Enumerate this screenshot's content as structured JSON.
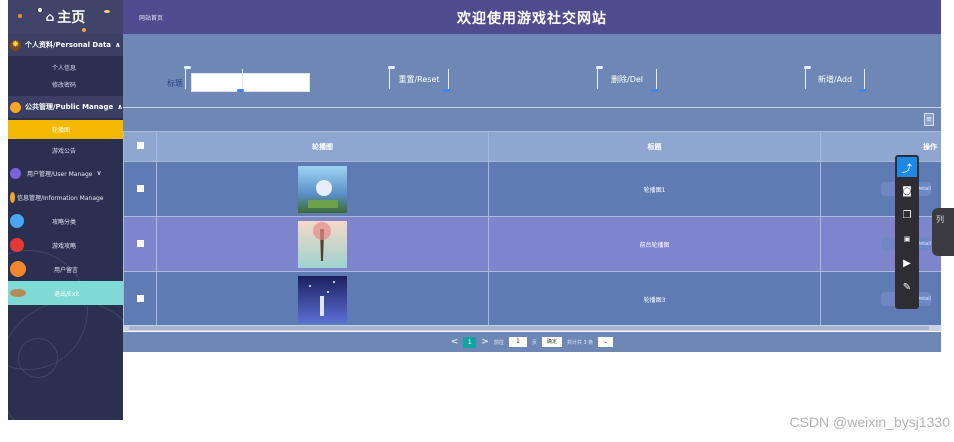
{
  "sidebar": {
    "home": "主页",
    "groups": [
      {
        "label": "个人资料/Personal Data",
        "caret": "∧",
        "icon": "monster-icon",
        "subitems": [
          "个人信息",
          "修改密码"
        ]
      },
      {
        "label": "公共管理/Public Manage",
        "caret": "∧",
        "icon": "orange-ball-icon",
        "subitems": [
          "轮播图",
          "游戏公告"
        ]
      }
    ],
    "items": [
      {
        "label": "用户管理/User Manage",
        "caret": "∨",
        "icon": "purple-ball-icon"
      },
      {
        "label": "信息管理/Information Manage",
        "caret": "",
        "icon": "orange-ball-icon"
      },
      {
        "label": "攻略分类",
        "icon": "blue-ball-icon"
      },
      {
        "label": "游戏攻略",
        "icon": "red-ball-icon"
      },
      {
        "label": "用户留言",
        "icon": "orange-planet-icon"
      },
      {
        "label": "退出/Exit",
        "icon": "saturn-icon"
      }
    ]
  },
  "header": {
    "breadcrumb": "网站首页",
    "title": "欢迎使用游戏社交网站"
  },
  "search": {
    "label": "标题",
    "value": ""
  },
  "toolbar": {
    "query": "查询/Query",
    "reset": "重置/Reset",
    "delete": "删除/Del",
    "add": "新增/Add"
  },
  "table": {
    "columns": [
      "轮播图",
      "标题",
      "操作"
    ],
    "rows": [
      {
        "title": "轮播图1",
        "action": "详情/Detail"
      },
      {
        "title": "前台轮播图",
        "action": "详情/Detail"
      },
      {
        "title": "轮播图3",
        "action": "详情/Detail"
      }
    ]
  },
  "pager": {
    "prev": "<",
    "current": "1",
    "next": ">",
    "goto_label": "前往",
    "goto_value": "1",
    "page_unit": "页",
    "confirm": "确定",
    "total": "共计共 3 条",
    "select_arrow": "⌄"
  },
  "floatbar": {
    "side_handle": "列"
  },
  "watermark": "CSDN @weixin_bysj1330"
}
